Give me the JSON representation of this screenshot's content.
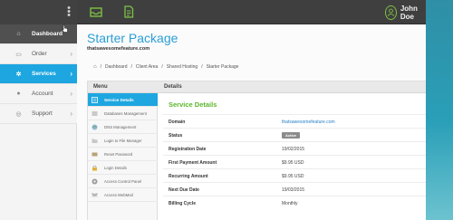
{
  "topbar": {
    "user_name": "John Doe"
  },
  "sidebar": {
    "items": [
      {
        "label": "Dashboard",
        "icon": "home-icon"
      },
      {
        "label": "Order",
        "icon": "cart-icon"
      },
      {
        "label": "Services",
        "icon": "gear-icon"
      },
      {
        "label": "Account",
        "icon": "user-icon"
      },
      {
        "label": "Support",
        "icon": "lifebuoy-icon"
      }
    ]
  },
  "page": {
    "title": "Starter Package",
    "subtitle": "thatsawesomefeature.com"
  },
  "breadcrumb": [
    "Dashboard",
    "Client Area",
    "Shared Hosting",
    "Starter Package"
  ],
  "panel": {
    "menu_header": "Menu",
    "details_header": "Details",
    "menu_items": [
      {
        "label": "Service Details"
      },
      {
        "label": "Databases Management"
      },
      {
        "label": "DNS Management"
      },
      {
        "label": "Login to File Manager"
      },
      {
        "label": "Reset Password"
      },
      {
        "label": "Login Details"
      },
      {
        "label": "Access Control Panel"
      },
      {
        "label": "Access WebMail"
      }
    ]
  },
  "service_details": {
    "title": "Service Details",
    "rows": [
      {
        "label": "Domain",
        "value": "thatsawesomefeature.com"
      },
      {
        "label": "Status",
        "value": "Active"
      },
      {
        "label": "Registration Date",
        "value": "19/02/2015"
      },
      {
        "label": "First Payment Amount",
        "value": "$9.95 USD"
      },
      {
        "label": "Recurring Amount",
        "value": "$9.95 USD"
      },
      {
        "label": "Next Due Date",
        "value": "19/03/2015"
      },
      {
        "label": "Billing Cycle",
        "value": "Monthly"
      }
    ]
  },
  "colors": {
    "accent": "#1da6e0",
    "title": "#2b9fd6",
    "section_green": "#5ab72b",
    "topbar": "#3f3f3f",
    "status_badge": "#8c8c8c"
  }
}
